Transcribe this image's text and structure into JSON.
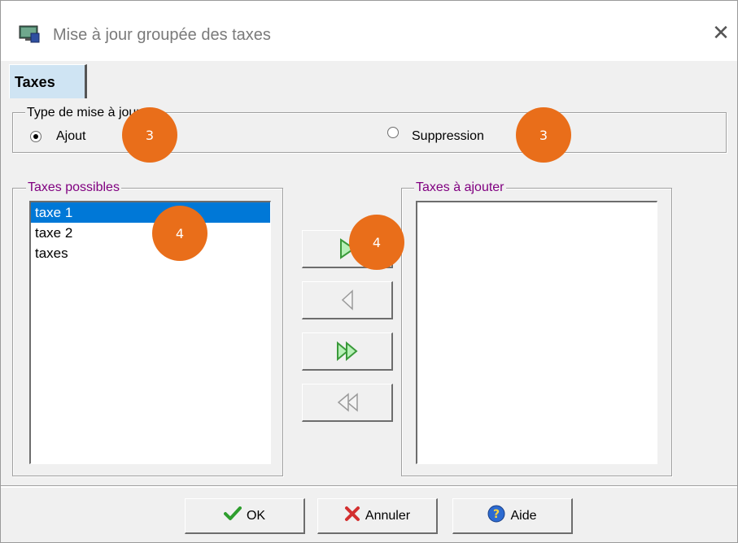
{
  "window": {
    "title": "Mise à jour groupée des taxes",
    "close_icon": "close-icon",
    "app_icon": "app-window-icon"
  },
  "tabs": [
    {
      "label": "Taxes",
      "selected": true
    }
  ],
  "update_type": {
    "label": "Type de mise à jour",
    "options": [
      {
        "label": "Ajout",
        "checked": true
      },
      {
        "label": "Suppression",
        "checked": false
      }
    ]
  },
  "available": {
    "label": "Taxes possibles",
    "items": [
      "taxe 1",
      "taxe 2",
      "taxes"
    ],
    "selected_index": 0
  },
  "to_add": {
    "label": "Taxes à ajouter",
    "items": []
  },
  "transfer_buttons": [
    {
      "icon": "move-right-icon",
      "enabled": true
    },
    {
      "icon": "move-left-icon",
      "enabled": false
    },
    {
      "icon": "move-all-right-icon",
      "enabled": true
    },
    {
      "icon": "move-all-left-icon",
      "enabled": false
    }
  ],
  "footer": {
    "ok_label": "OK",
    "cancel_label": "Annuler",
    "help_label": "Aide"
  },
  "annotations": [
    "3",
    "3",
    "4",
    "4"
  ],
  "colors": {
    "selection": "#0078d7",
    "badge": "#e96e1a",
    "tab_selected": "#cfe4f3",
    "group_label_purple": "#800080"
  }
}
